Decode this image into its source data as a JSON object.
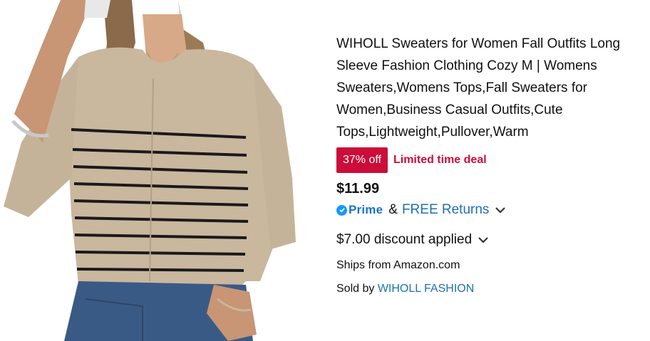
{
  "product": {
    "image_alt": "Striped crewneck sweater",
    "title": "WIHOLL Sweaters for Women Fall Outfits Long Sleeve Fashion Clothing Cozy M | Womens Sweaters,Womens Tops,Fall Sweaters for Women,Business Casual Outfits,Cute Tops,Lightweight,Pullover,Warm",
    "deal_badge": "37% off",
    "deal_text": "Limited time deal",
    "price": "$11.99",
    "prime_label": "Prime",
    "amp": "&",
    "returns_label": "FREE Returns",
    "discount_label": "$7.00 discount applied",
    "ships_from": "Ships from Amazon.com",
    "sold_by_prefix": "Sold by",
    "seller": "WIHOLL FASHION"
  },
  "colors": {
    "deal_red": "#cc0c39",
    "link_blue": "#1f6fb2",
    "prime_blue": "#1399ff",
    "text": "#0f1111"
  },
  "icons": {
    "prime_check": "check-icon",
    "returns_chevron": "chevron-down-icon",
    "discount_chevron": "chevron-down-icon"
  }
}
